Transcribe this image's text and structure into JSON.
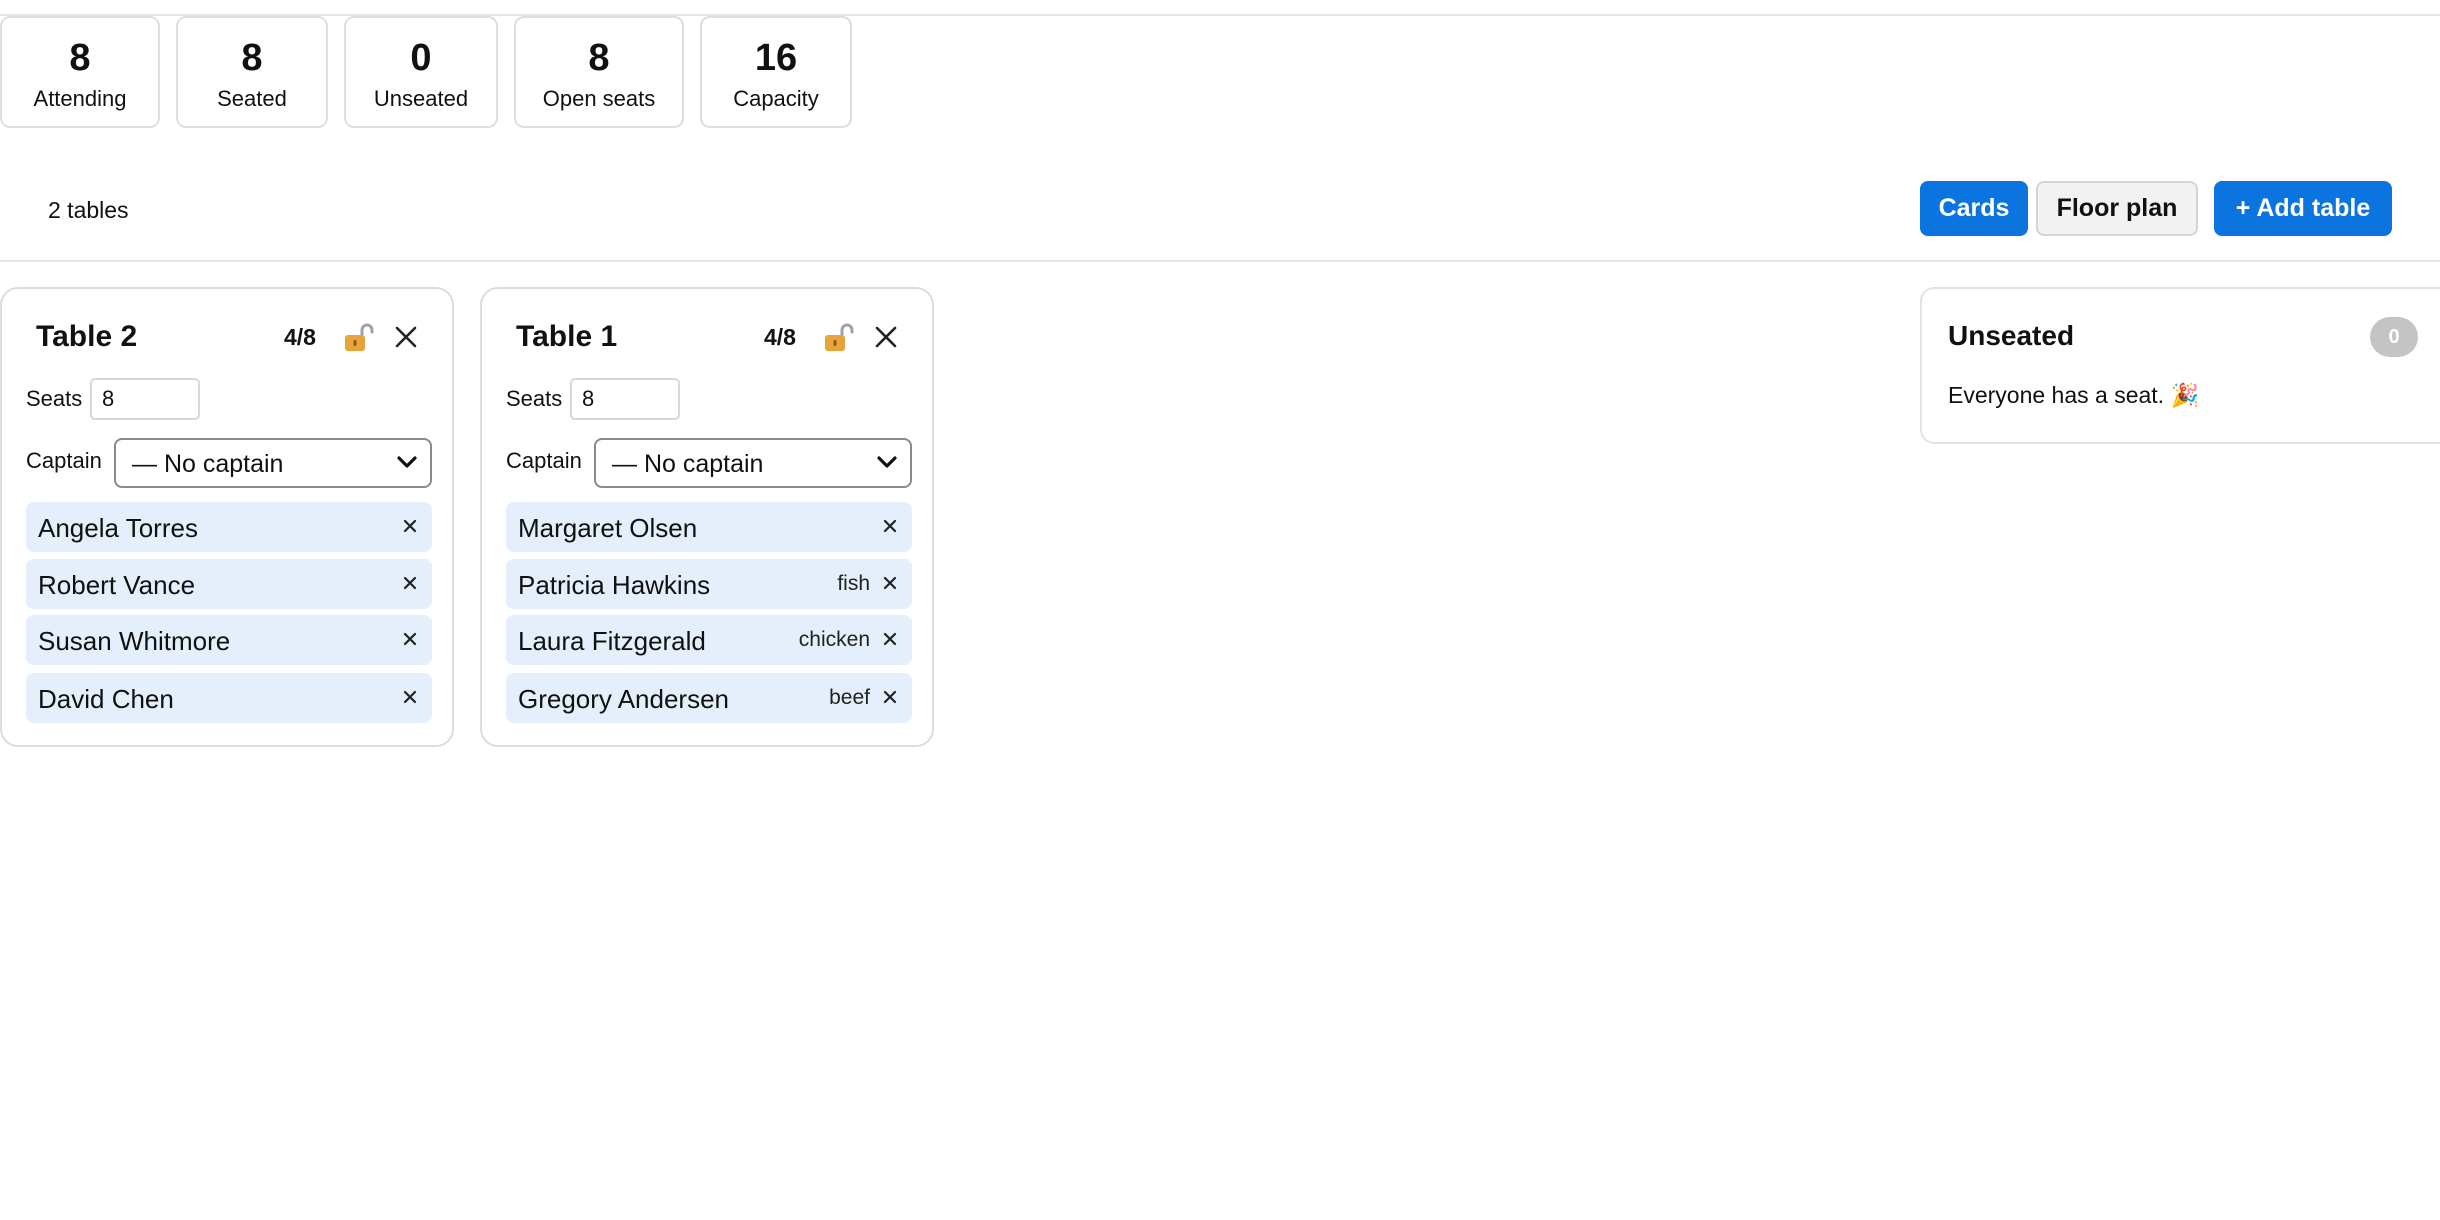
{
  "stats": [
    {
      "value": "8",
      "label": "Attending"
    },
    {
      "value": "8",
      "label": "Seated"
    },
    {
      "value": "0",
      "label": "Unseated"
    },
    {
      "value": "8",
      "label": "Open seats"
    },
    {
      "value": "16",
      "label": "Capacity"
    }
  ],
  "toolbar": {
    "table_count": "2 tables",
    "cards_label": "Cards",
    "floor_plan_label": "Floor plan",
    "add_table_label": "+ Add table"
  },
  "tables": [
    {
      "name": "Table 2",
      "occupancy": "4/8",
      "seats_label": "Seats",
      "seats_value": "8",
      "captain_label": "Captain",
      "captain_value": "— No captain",
      "guests": [
        {
          "name": "Angela Torres",
          "meal": ""
        },
        {
          "name": "Robert Vance",
          "meal": ""
        },
        {
          "name": "Susan Whitmore",
          "meal": ""
        },
        {
          "name": "David Chen",
          "meal": ""
        }
      ]
    },
    {
      "name": "Table 1",
      "occupancy": "4/8",
      "seats_label": "Seats",
      "seats_value": "8",
      "captain_label": "Captain",
      "captain_value": "— No captain",
      "guests": [
        {
          "name": "Margaret Olsen",
          "meal": ""
        },
        {
          "name": "Patricia Hawkins",
          "meal": "fish"
        },
        {
          "name": "Laura Fitzgerald",
          "meal": "chicken"
        },
        {
          "name": "Gregory Andersen",
          "meal": "beef"
        }
      ]
    }
  ],
  "unseated": {
    "title": "Unseated",
    "count": "0",
    "message": "Everyone has a seat. 🎉"
  },
  "colors": {
    "accent": "#0b74de",
    "guest_chip": "#e4effb",
    "badge": "#c4c4c4",
    "lock": "#e8a33a"
  },
  "icons": {
    "lock": "unlocked-padlock-icon",
    "close": "close-icon",
    "remove": "remove-x-icon",
    "chevron": "chevron-down-icon"
  }
}
